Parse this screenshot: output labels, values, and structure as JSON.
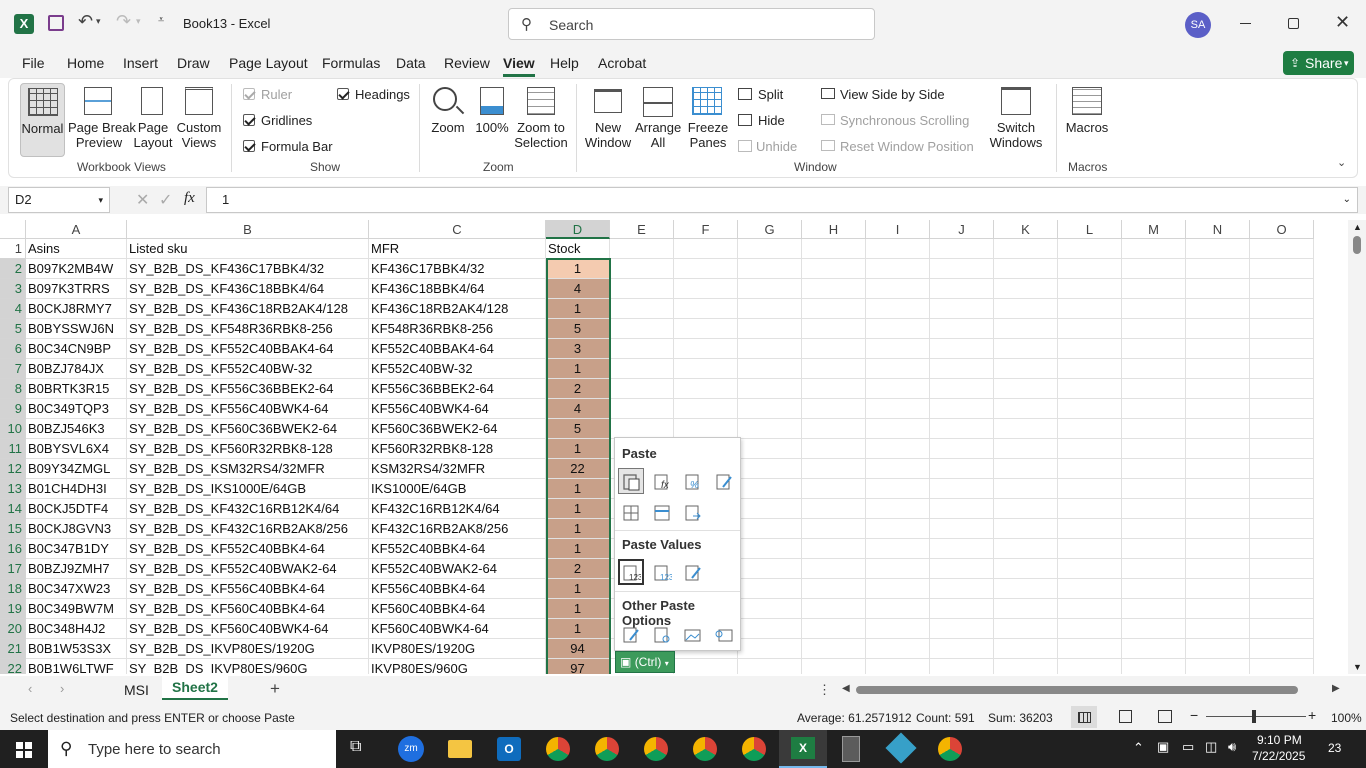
{
  "app": {
    "title": "Book13 - Excel",
    "search_placeholder": "Search",
    "user_initials": "SA"
  },
  "menu_tabs": [
    "File",
    "Home",
    "Insert",
    "Draw",
    "Page Layout",
    "Formulas",
    "Data",
    "Review",
    "View",
    "Help",
    "Acrobat"
  ],
  "active_tab": "View",
  "share_label": "Share",
  "ribbon": {
    "workbook_views": {
      "label": "Workbook Views",
      "normal": "Normal",
      "page_break": "Page Break\nPreview",
      "page_layout": "Page\nLayout",
      "custom": "Custom\nViews"
    },
    "show": {
      "label": "Show",
      "ruler": "Ruler",
      "gridlines": "Gridlines",
      "formula_bar": "Formula Bar",
      "headings": "Headings"
    },
    "zoom": {
      "label": "Zoom",
      "zoom": "Zoom",
      "hundred": "100%",
      "to_selection": "Zoom to\nSelection"
    },
    "window": {
      "label": "Window",
      "new_window": "New\nWindow",
      "arrange_all": "Arrange\nAll",
      "freeze": "Freeze\nPanes",
      "split": "Split",
      "hide": "Hide",
      "unhide": "Unhide",
      "side_by_side": "View Side by Side",
      "sync_scroll": "Synchronous Scrolling",
      "reset_pos": "Reset Window Position",
      "switch": "Switch\nWindows"
    },
    "macros": {
      "label": "Macros",
      "macros": "Macros"
    }
  },
  "formula_bar": {
    "name_box": "D2",
    "fx": "fx",
    "value": "1"
  },
  "columns": [
    "A",
    "B",
    "C",
    "D",
    "E",
    "F",
    "G",
    "H",
    "I",
    "J",
    "K",
    "L",
    "M",
    "N",
    "O"
  ],
  "rows": [
    {
      "n": "1",
      "a": "Asins",
      "b": "Listed sku",
      "c": "MFR",
      "d": "Stock"
    },
    {
      "n": "2",
      "a": "B097K2MB4W",
      "b": "SY_B2B_DS_KF436C17BBK4/32",
      "c": "KF436C17BBK4/32",
      "d": "1"
    },
    {
      "n": "3",
      "a": "B097K3TRRS",
      "b": "SY_B2B_DS_KF436C18BBK4/64",
      "c": "KF436C18BBK4/64",
      "d": "4"
    },
    {
      "n": "4",
      "a": "B0CKJ8RMY7",
      "b": "SY_B2B_DS_KF436C18RB2AK4/128",
      "c": "KF436C18RB2AK4/128",
      "d": "1"
    },
    {
      "n": "5",
      "a": "B0BYSSWJ6N",
      "b": "SY_B2B_DS_KF548R36RBK8-256",
      "c": "KF548R36RBK8-256",
      "d": "5"
    },
    {
      "n": "6",
      "a": "B0C34CN9BP",
      "b": "SY_B2B_DS_KF552C40BBAK4-64",
      "c": "KF552C40BBAK4-64",
      "d": "3"
    },
    {
      "n": "7",
      "a": "B0BZJ784JX",
      "b": "SY_B2B_DS_KF552C40BW-32",
      "c": "KF552C40BW-32",
      "d": "1"
    },
    {
      "n": "8",
      "a": "B0BRTK3R15",
      "b": "SY_B2B_DS_KF556C36BBEK2-64",
      "c": "KF556C36BBEK2-64",
      "d": "2"
    },
    {
      "n": "9",
      "a": "B0C349TQP3",
      "b": "SY_B2B_DS_KF556C40BWK4-64",
      "c": "KF556C40BWK4-64",
      "d": "4"
    },
    {
      "n": "10",
      "a": "B0BZJ546K3",
      "b": "SY_B2B_DS_KF560C36BWEK2-64",
      "c": "KF560C36BWEK2-64",
      "d": "5"
    },
    {
      "n": "11",
      "a": "B0BYSVL6X4",
      "b": "SY_B2B_DS_KF560R32RBK8-128",
      "c": "KF560R32RBK8-128",
      "d": "1"
    },
    {
      "n": "12",
      "a": "B09Y34ZMGL",
      "b": "SY_B2B_DS_KSM32RS4/32MFR",
      "c": "KSM32RS4/32MFR",
      "d": "22"
    },
    {
      "n": "13",
      "a": "B01CH4DH3I",
      "b": "SY_B2B_DS_IKS1000E/64GB",
      "c": "IKS1000E/64GB",
      "d": "1"
    },
    {
      "n": "14",
      "a": "B0CKJ5DTF4",
      "b": "SY_B2B_DS_KF432C16RB12K4/64",
      "c": "KF432C16RB12K4/64",
      "d": "1"
    },
    {
      "n": "15",
      "a": "B0CKJ8GVN3",
      "b": "SY_B2B_DS_KF432C16RB2AK8/256",
      "c": "KF432C16RB2AK8/256",
      "d": "1"
    },
    {
      "n": "16",
      "a": "B0C347B1DY",
      "b": "SY_B2B_DS_KF552C40BBK4-64",
      "c": "KF552C40BBK4-64",
      "d": "1"
    },
    {
      "n": "17",
      "a": "B0BZJ9ZMH7",
      "b": "SY_B2B_DS_KF552C40BWAK2-64",
      "c": "KF552C40BWAK2-64",
      "d": "2"
    },
    {
      "n": "18",
      "a": "B0C347XW23",
      "b": "SY_B2B_DS_KF556C40BBK4-64",
      "c": "KF556C40BBK4-64",
      "d": "1"
    },
    {
      "n": "19",
      "a": "B0C349BW7M",
      "b": "SY_B2B_DS_KF560C40BBK4-64",
      "c": "KF560C40BBK4-64",
      "d": "1"
    },
    {
      "n": "20",
      "a": "B0C348H4J2",
      "b": "SY_B2B_DS_KF560C40BWK4-64",
      "c": "KF560C40BWK4-64",
      "d": "1"
    },
    {
      "n": "21",
      "a": "B0B1W53S3X",
      "b": "SY_B2B_DS_IKVP80ES/1920G",
      "c": "IKVP80ES/1920G",
      "d": "94"
    },
    {
      "n": "22",
      "a": "B0B1W6LTWF",
      "b": "SY_B2B_DS_IKVP80ES/960G",
      "c": "IKVP80ES/960G",
      "d": "97"
    }
  ],
  "paste_menu": {
    "paste": "Paste",
    "paste_values": "Paste Values",
    "other": "Other Paste Options",
    "ctrl": "(Ctrl)"
  },
  "sheets": [
    "MSI",
    "Sheet2"
  ],
  "active_sheet": "Sheet2",
  "status": {
    "message": "Select destination and press ENTER or choose Paste",
    "average": "Average: 61.2571912",
    "count": "Count: 591",
    "sum": "Sum: 36203",
    "zoom": "100%"
  },
  "taskbar": {
    "search_placeholder": "Type here to search",
    "time": "9:10 PM",
    "date": "7/22/2025",
    "notif_count": "23"
  },
  "colors": {
    "excel_green": "#217346",
    "stock_fill": "#c8a089",
    "share_green": "#1e7d42"
  }
}
